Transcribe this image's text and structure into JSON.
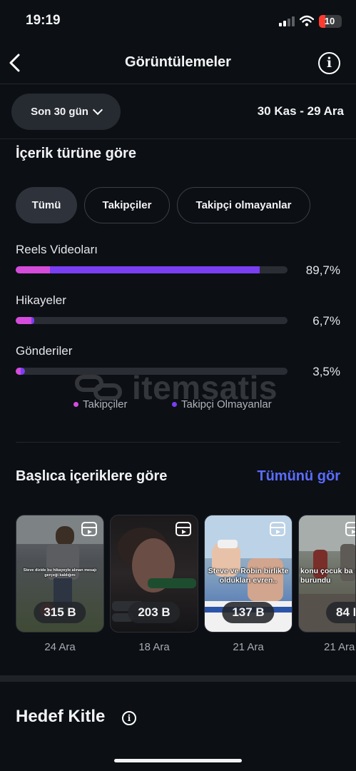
{
  "status_bar": {
    "time": "19:19",
    "battery": "10"
  },
  "header": {
    "title": "Görüntülemeler",
    "info_icon": "info-icon",
    "back_icon": "chevron-left-icon"
  },
  "filter": {
    "range_label": "Son 30 gün",
    "date_range": "30 Kas - 29 Ara"
  },
  "content_type": {
    "heading": "İçerik türüne göre",
    "chips": [
      "Tümü",
      "Takipçiler",
      "Takipçi olmayanlar"
    ],
    "active_chip": "Tümü",
    "rows": [
      {
        "label": "Reels Videoları",
        "percent": "89,7%",
        "total_fill": 0.897,
        "followers_share": 0.14
      },
      {
        "label": "Hikayeler",
        "percent": "6,7%",
        "total_fill": 0.067,
        "followers_share": 0.85
      },
      {
        "label": "Gönderiler",
        "percent": "3,5%",
        "total_fill": 0.035,
        "followers_share": 0.55
      }
    ],
    "legend": [
      {
        "label": "Takipçiler",
        "color": "#d54cdb"
      },
      {
        "label": "Takipçi Olmayanlar",
        "color": "#7a3ef3"
      }
    ]
  },
  "top_content": {
    "heading": "Başlıca içeriklere göre",
    "see_all": "Tümünü gör",
    "items": [
      {
        "views": "315 B",
        "date": "24 Ara",
        "caption": "Steve dizide bu hikayeyle alınan mesajı gerçeği kaldığını"
      },
      {
        "views": "203 B",
        "date": "18 Ara",
        "caption": ""
      },
      {
        "views": "137 B",
        "date": "21 Ara",
        "caption": "Steve ve Robin birlikte oldukları evren.."
      },
      {
        "views": "84 B",
        "date": "21 Ara",
        "caption": "konu çocuk ba olunca burundu"
      }
    ]
  },
  "audience": {
    "heading": "Hedef Kitle"
  },
  "watermark": {
    "text": "itemsatis"
  },
  "colors": {
    "accent_link": "#5a6cff",
    "followers": "#d54cdb",
    "non_followers": "#7a3ef3"
  }
}
